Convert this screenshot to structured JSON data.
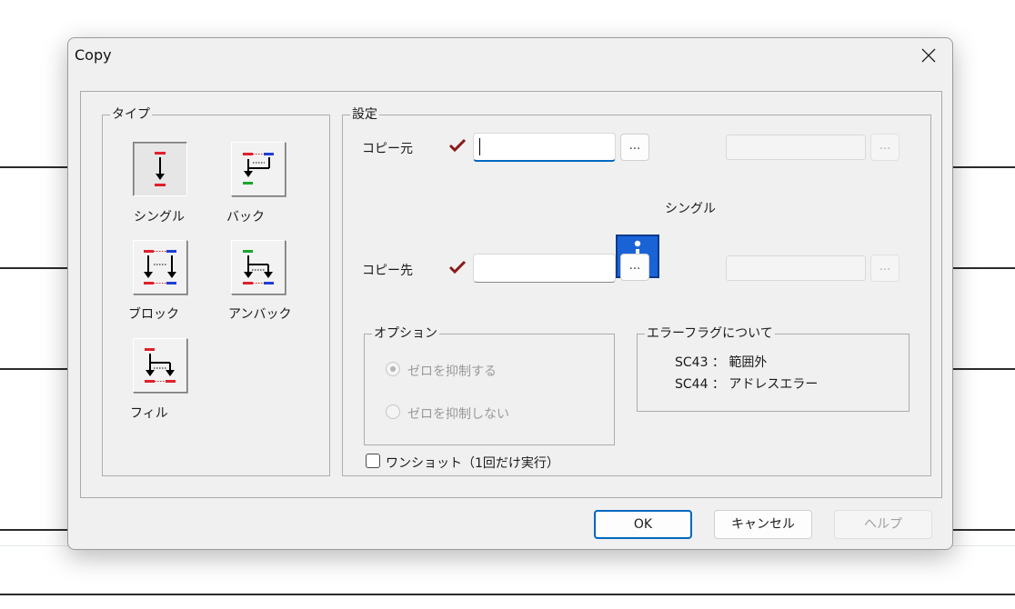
{
  "dialog": {
    "title": "Copy"
  },
  "type_group": {
    "legend": "タイプ",
    "items": [
      {
        "label": "シングル",
        "selected": true
      },
      {
        "label": "バック",
        "selected": false
      },
      {
        "label": "ブロック",
        "selected": false
      },
      {
        "label": "アンバック",
        "selected": false
      },
      {
        "label": "フィル",
        "selected": false
      }
    ]
  },
  "settings": {
    "legend": "設定",
    "source": {
      "label": "コピー元",
      "value": "",
      "browse_label": "...",
      "extra_value": "",
      "extra_browse_label": "..."
    },
    "dest": {
      "label": "コピー先",
      "value": "",
      "browse_label": "...",
      "extra_value": "",
      "extra_browse_label": "..."
    },
    "mode_label": "シングル",
    "options": {
      "legend": "オプション",
      "items": [
        {
          "label": "ゼロを抑制する",
          "selected": true,
          "enabled": false
        },
        {
          "label": "ゼロを抑制しない",
          "selected": false,
          "enabled": false
        }
      ]
    },
    "error_flags": {
      "legend": "エラーフラグについて",
      "lines": [
        "SC43 ： 範囲外",
        "SC44 ： アドレスエラー"
      ]
    },
    "one_shot": {
      "label": "ワンショット（1回だけ実行）",
      "checked": false
    }
  },
  "buttons": {
    "ok": "OK",
    "cancel": "キャンセル",
    "help": "ヘルプ"
  },
  "colors": {
    "accent": "#0067c0",
    "check_mark": "#8b1a1a",
    "icon_blue": "#1a63d6",
    "marker_red": "#e0202a",
    "marker_blue": "#1f3fd6",
    "marker_green": "#1aa52c"
  }
}
